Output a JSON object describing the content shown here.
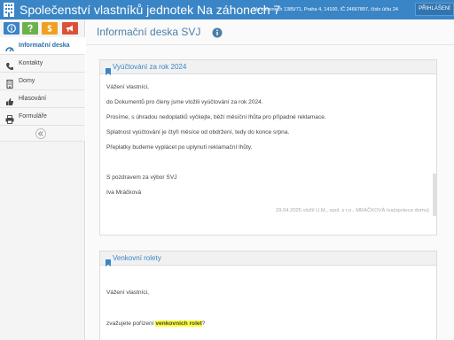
{
  "header": {
    "title": "Společenství vlastníků jednotek Na záhonech 7",
    "address": "Na záhonech 1385/71, Praha 4, 14100, IČ 24667897, číslo účtu 24",
    "login_label": "PŘIHLÁŠENÍ",
    "colors": {
      "bar": "#3a85c6",
      "button": "#3175b0"
    }
  },
  "shortcuts": [
    {
      "icon": "info-icon",
      "color": "#3a85c6"
    },
    {
      "icon": "question-icon",
      "color": "#6cb24a"
    },
    {
      "icon": "dollar-icon",
      "color": "#f0a020"
    },
    {
      "icon": "megaphone-icon",
      "color": "#d9533a"
    }
  ],
  "sidebar": {
    "items": [
      {
        "label": "Informační deska",
        "icon": "dashboard-icon",
        "active": true
      },
      {
        "label": "Kontakty",
        "icon": "phone-icon",
        "active": false
      },
      {
        "label": "Domy",
        "icon": "building-icon",
        "active": false
      },
      {
        "label": "Hlasování",
        "icon": "thumbs-up-icon",
        "active": false
      },
      {
        "label": "Formuláře",
        "icon": "printer-icon",
        "active": false
      }
    ],
    "collapse_icon": "double-chevron-left-icon"
  },
  "main": {
    "title": "Informační deska SVJ"
  },
  "posts": [
    {
      "title": "Vyúčtování za rok 2024",
      "lines": [
        "Vážení vlastníci,",
        "do Dokumentů pro členy jsme vložili vyúčtování za rok 2024.",
        "Prosíme, s úhradou nedoplatků vyčkejte, běží měsíční lhůta pro případné reklamace.",
        "Splatnost vyúčtování je čtyři měsíce od obdržení, tedy do konce srpna.",
        "Přeplatky budeme vyplácet po uplynutí reklamační lhůty.",
        "",
        "S pozdravem za výbor SVJ",
        "Iva Mráčková"
      ],
      "signature": "29.04.2025 vložil U.M., spol. s r.o., MRÁČKOVÁ Iva(správce domu)"
    },
    {
      "title": "Venkovní rolety",
      "lines": [
        "Vážení vlastníci,",
        "zvažujete pořízení "
      ],
      "highlight": "venkovních rolet",
      "after_highlight": "?"
    }
  ]
}
